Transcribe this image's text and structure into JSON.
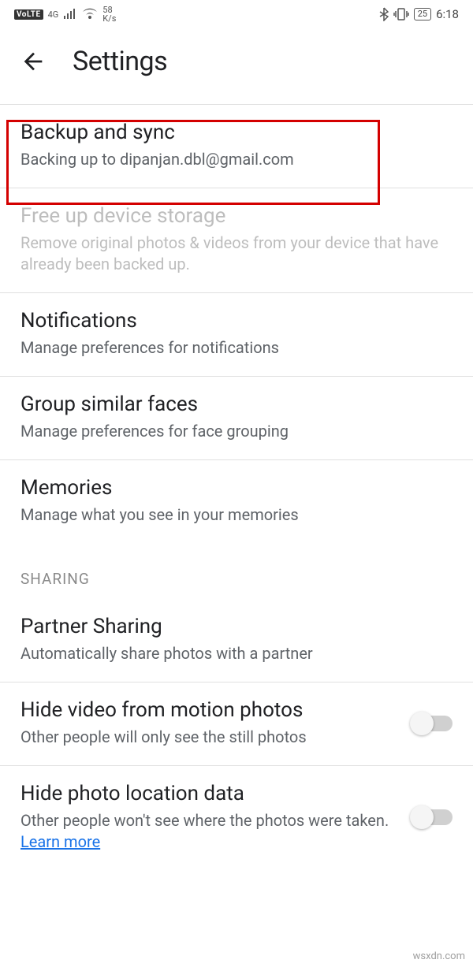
{
  "status_bar": {
    "volte": "VoLTE",
    "net_label": "4G",
    "speed_top": "58",
    "speed_bottom": "K/s",
    "battery": "25",
    "time": "6:18"
  },
  "header": {
    "title": "Settings"
  },
  "items": {
    "backup": {
      "title": "Backup and sync",
      "sub": "Backing up to dipanjan.dbl@gmail.com"
    },
    "freeup": {
      "title": "Free up device storage",
      "sub": "Remove original photos & videos from your device that have already been backed up."
    },
    "notifications": {
      "title": "Notifications",
      "sub": "Manage preferences for notifications"
    },
    "faces": {
      "title": "Group similar faces",
      "sub": "Manage preferences for face grouping"
    },
    "memories": {
      "title": "Memories",
      "sub": "Manage what you see in your memories"
    }
  },
  "section": {
    "sharing": "SHARING"
  },
  "sharing_items": {
    "partner": {
      "title": "Partner Sharing",
      "sub": "Automatically share photos with a partner"
    },
    "hide_video": {
      "title": "Hide video from motion photos",
      "sub": "Other people will only see the still photos"
    },
    "hide_location": {
      "title": "Hide photo location data",
      "sub": "Other people won't see where the photos were taken. ",
      "link": "Learn more"
    }
  },
  "watermark": "wsxdn.com"
}
